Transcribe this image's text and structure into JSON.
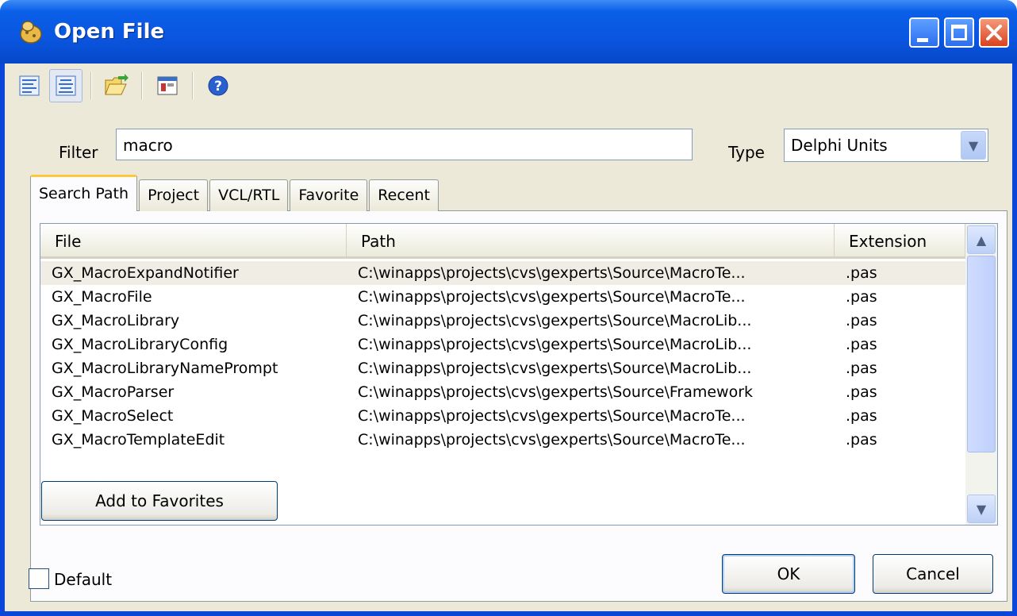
{
  "window": {
    "title": "Open File"
  },
  "toolbar": {
    "buttons": [
      "list-view-icon",
      "details-view-icon",
      "open-folder-icon",
      "window-icon",
      "help-icon"
    ]
  },
  "filter": {
    "label": "Filter",
    "value": "macro"
  },
  "type": {
    "label": "Type",
    "selected": "Delphi Units"
  },
  "tabs": [
    {
      "label": "Search Path"
    },
    {
      "label": "Project"
    },
    {
      "label": "VCL/RTL"
    },
    {
      "label": "Favorite"
    },
    {
      "label": "Recent"
    }
  ],
  "list": {
    "columns": {
      "file": "File",
      "path": "Path",
      "extension": "Extension"
    },
    "rows": [
      {
        "file": "GX_MacroExpandNotifier",
        "path": "C:\\winapps\\projects\\cvs\\gexperts\\Source\\MacroTe...",
        "ext": ".pas"
      },
      {
        "file": "GX_MacroFile",
        "path": "C:\\winapps\\projects\\cvs\\gexperts\\Source\\MacroTe...",
        "ext": ".pas"
      },
      {
        "file": "GX_MacroLibrary",
        "path": "C:\\winapps\\projects\\cvs\\gexperts\\Source\\MacroLib...",
        "ext": ".pas"
      },
      {
        "file": "GX_MacroLibraryConfig",
        "path": "C:\\winapps\\projects\\cvs\\gexperts\\Source\\MacroLib...",
        "ext": ".pas"
      },
      {
        "file": "GX_MacroLibraryNamePrompt",
        "path": "C:\\winapps\\projects\\cvs\\gexperts\\Source\\MacroLib...",
        "ext": ".pas"
      },
      {
        "file": "GX_MacroParser",
        "path": "C:\\winapps\\projects\\cvs\\gexperts\\Source\\Framework",
        "ext": ".pas"
      },
      {
        "file": "GX_MacroSelect",
        "path": "C:\\winapps\\projects\\cvs\\gexperts\\Source\\MacroTe...",
        "ext": ".pas"
      },
      {
        "file": "GX_MacroTemplateEdit",
        "path": "C:\\winapps\\projects\\cvs\\gexperts\\Source\\MacroTe...",
        "ext": ".pas"
      }
    ]
  },
  "buttons": {
    "add_favorites": "Add to Favorites",
    "ok": "OK",
    "cancel": "Cancel"
  },
  "default_checkbox": {
    "label": "Default",
    "checked": false
  },
  "colors": {
    "title_bar": "#0a56e0",
    "dialog_bg": "#ece9d8",
    "tab_highlight": "#ffc83c",
    "close_button": "#d9421f"
  }
}
